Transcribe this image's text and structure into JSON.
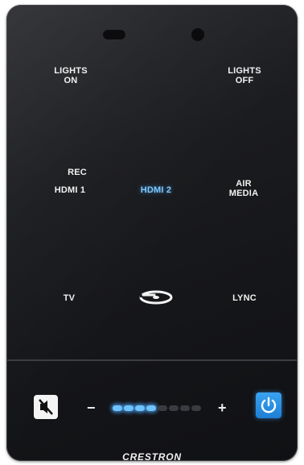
{
  "buttons": {
    "lights_on": [
      "LIGHTS",
      "ON"
    ],
    "lights_off": [
      "LIGHTS",
      "OFF"
    ],
    "rec": "REC",
    "hdmi1": "HDMI 1",
    "hdmi2": "HDMI 2",
    "air_media": [
      "AIR",
      "MEDIA"
    ],
    "tv": "TV",
    "bluray_icon": "bluray-disc-icon",
    "lync": "LYNC"
  },
  "active_source": "HDMI 2",
  "volume": {
    "minus_label": "−",
    "plus_label": "+",
    "level_segments_on": 4,
    "total_segments": 8,
    "mute_icon": "speaker-muted-icon"
  },
  "power_icon": "power-icon",
  "brand": "CRESTRON",
  "colors": {
    "panel": "#1b1c1f",
    "active_blue": "#7ec8ff",
    "power_blue": "#1d7fd6"
  }
}
